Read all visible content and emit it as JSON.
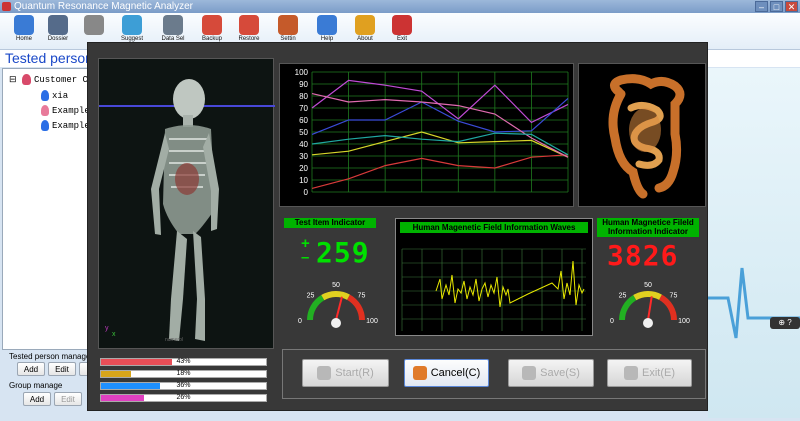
{
  "window": {
    "title": "Quantum Resonance Magnetic Analyzer",
    "min": "–",
    "max": "□",
    "close": "✕"
  },
  "toolbar": {
    "items": [
      {
        "label": "Home",
        "icon": "home-icon",
        "color": "#3a7bd5"
      },
      {
        "label": "Dossier",
        "icon": "dossier-icon",
        "color": "#556b8a"
      },
      {
        "label": "",
        "icon": "eye-icon",
        "color": "#888888"
      },
      {
        "label": "Suggest",
        "icon": "suggest-icon",
        "color": "#3d9ed6"
      },
      {
        "label": "Data Sel",
        "icon": "data-icon",
        "color": "#6b7b8c"
      },
      {
        "label": "Backup",
        "icon": "backup-icon",
        "color": "#d64a3a"
      },
      {
        "label": "Restore",
        "icon": "restore-icon",
        "color": "#d64a3a"
      },
      {
        "label": "Settin",
        "icon": "settings-icon",
        "color": "#c55a2a"
      },
      {
        "label": "Help",
        "icon": "help-icon",
        "color": "#3a7bd5"
      },
      {
        "label": "About",
        "icon": "about-icon",
        "color": "#e0a020"
      },
      {
        "label": "Exit",
        "icon": "exit-icon",
        "color": "#cc3333"
      }
    ]
  },
  "tested_header": "Tested person m",
  "tree": {
    "root": "Customer C",
    "expander": "⊟",
    "people": [
      "xia",
      "Example",
      "Example"
    ]
  },
  "tested_group": {
    "label": "Tested person manage",
    "buttons": [
      "Add",
      "Edit",
      "D"
    ]
  },
  "group_manage": {
    "label": "Group manage",
    "buttons": [
      "Add",
      "Edit"
    ]
  },
  "help_badge": "⊕ ?",
  "body_panel": {
    "axis_y": "y",
    "axis_x": "x",
    "caption": "numerol"
  },
  "bars": [
    {
      "pct": "43%",
      "value": 0.43,
      "color": "#e84e57"
    },
    {
      "pct": "18%",
      "value": 0.18,
      "color": "#d8a51a"
    },
    {
      "pct": "36%",
      "value": 0.36,
      "color": "#1e90ff"
    },
    {
      "pct": "26%",
      "value": 0.26,
      "color": "#e040c0"
    }
  ],
  "chart_data": {
    "type": "line",
    "title": "",
    "xlabel": "",
    "ylabel": "",
    "ylim": [
      0,
      100
    ],
    "y_ticks": [
      "0",
      "10",
      "20",
      "30",
      "40",
      "50",
      "60",
      "70",
      "80",
      "90",
      "100"
    ],
    "grid": true,
    "x": [
      0,
      1,
      2,
      3,
      4,
      5,
      6,
      7
    ],
    "series": [
      {
        "values": [
          70,
          93,
          89,
          84,
          61,
          89,
          58,
          73
        ],
        "color": "#c04bd6"
      },
      {
        "values": [
          48,
          60,
          60,
          75,
          59,
          50,
          51,
          78
        ],
        "color": "#3a4bd8"
      },
      {
        "values": [
          31,
          34,
          42,
          50,
          41,
          42,
          43,
          29
        ],
        "color": "#d6d62a"
      },
      {
        "values": [
          3,
          11,
          22,
          28,
          22,
          20,
          29,
          31
        ],
        "color": "#d83a3a"
      },
      {
        "values": [
          82,
          75,
          77,
          75,
          72,
          65,
          45,
          29
        ],
        "color": "#e06bb0"
      },
      {
        "values": [
          40,
          44,
          47,
          44,
          42,
          49,
          48,
          31
        ],
        "color": "#20a8a0"
      }
    ]
  },
  "left_indicator": {
    "label": "Test Item Indicator",
    "digits": "259",
    "plus": "+",
    "minus": "–"
  },
  "right_indicator": {
    "label": "Human Magnetice Fileld Information Indicator",
    "digits": "3826"
  },
  "gauges": {
    "ticks": [
      "0",
      "25",
      "50",
      "75",
      "100"
    ],
    "left_value": 0.58,
    "right_value": 0.55
  },
  "waves": {
    "label": "Human Magenetic  Field Information Waves"
  },
  "actions": [
    {
      "label": "Start(R)",
      "icon": "start-icon",
      "active": false
    },
    {
      "label": "Cancel(C)",
      "icon": "cancel-icon",
      "active": true
    },
    {
      "label": "Save(S)",
      "icon": "save-icon",
      "active": false
    },
    {
      "label": "Exit(E)",
      "icon": "exit-action-icon",
      "active": false
    }
  ]
}
